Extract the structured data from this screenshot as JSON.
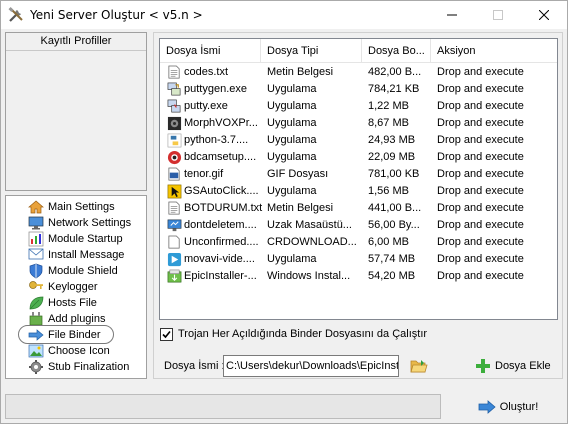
{
  "window": {
    "title": "Yeni Server Oluştur < v5.n >"
  },
  "profiles": {
    "header": "Kayıtlı Profiller"
  },
  "nav": [
    {
      "label": "Main Settings",
      "icon": "house-icon"
    },
    {
      "label": "Network Settings",
      "icon": "monitor-icon"
    },
    {
      "label": "Module Startup",
      "icon": "chart-icon"
    },
    {
      "label": "Install Message",
      "icon": "message-icon"
    },
    {
      "label": "Module Shield",
      "icon": "shield-icon"
    },
    {
      "label": "Keylogger",
      "icon": "key-icon"
    },
    {
      "label": "Hosts File",
      "icon": "leaf-icon"
    },
    {
      "label": "Add plugins",
      "icon": "plugin-icon"
    },
    {
      "label": "File Binder",
      "icon": "binder-icon"
    },
    {
      "label": "Choose Icon",
      "icon": "image-icon"
    },
    {
      "label": "Stub Finalization",
      "icon": "gear-icon"
    }
  ],
  "table": {
    "columns": [
      "Dosya İsmi",
      "Dosya Tipi",
      "Dosya Bo...",
      "Aksiyon"
    ],
    "rows": [
      {
        "name": "codes.txt",
        "type": "Metin Belgesi",
        "size": "482,00 B...",
        "action": "Drop and execute",
        "icon": "text-file-icon"
      },
      {
        "name": "puttygen.exe",
        "type": "Uygulama",
        "size": "784,21 KB",
        "action": "Drop and execute",
        "icon": "puttygen-icon"
      },
      {
        "name": "putty.exe",
        "type": "Uygulama",
        "size": "1,22 MB",
        "action": "Drop and execute",
        "icon": "putty-icon"
      },
      {
        "name": "MorphVOXPr...",
        "type": "Uygulama",
        "size": "8,67 MB",
        "action": "Drop and execute",
        "icon": "morphvox-icon"
      },
      {
        "name": "python-3.7....",
        "type": "Uygulama",
        "size": "24,93 MB",
        "action": "Drop and execute",
        "icon": "python-icon"
      },
      {
        "name": "bdcamsetup....",
        "type": "Uygulama",
        "size": "22,09 MB",
        "action": "Drop and execute",
        "icon": "bandicam-icon"
      },
      {
        "name": "tenor.gif",
        "type": "GIF Dosyası",
        "size": "781,00 KB",
        "action": "Drop and execute",
        "icon": "gif-file-icon"
      },
      {
        "name": "GSAutoClick....",
        "type": "Uygulama",
        "size": "1,56 MB",
        "action": "Drop and execute",
        "icon": "autoclicker-icon"
      },
      {
        "name": "BOTDURUM.txt",
        "type": "Metin Belgesi",
        "size": "441,00 B...",
        "action": "Drop and execute",
        "icon": "text-file-icon"
      },
      {
        "name": "dontdeletem....",
        "type": "Uzak Masaüstü...",
        "size": "56,00 By...",
        "action": "Drop and execute",
        "icon": "remote-desktop-icon"
      },
      {
        "name": "Unconfirmed....",
        "type": "CRDOWNLOAD...",
        "size": "6,00 MB",
        "action": "Drop and execute",
        "icon": "blank-file-icon"
      },
      {
        "name": "movavi-vide....",
        "type": "Uygulama",
        "size": "57,74 MB",
        "action": "Drop and execute",
        "icon": "movavi-icon"
      },
      {
        "name": "EpicInstaller-...",
        "type": "Windows Instal...",
        "size": "54,20 MB",
        "action": "Drop and execute",
        "icon": "installer-icon"
      }
    ]
  },
  "binder": {
    "checkbox_label": "Trojan Her Açıldığında Binder Dosyasını da Çalıştır",
    "checked": true,
    "file_label": "Dosya İsmi :",
    "file_value": "C:\\Users\\dekur\\Downloads\\EpicInst",
    "add_label": "Dosya Ekle"
  },
  "footer": {
    "build_label": "Oluştur!",
    "progress": 0
  }
}
